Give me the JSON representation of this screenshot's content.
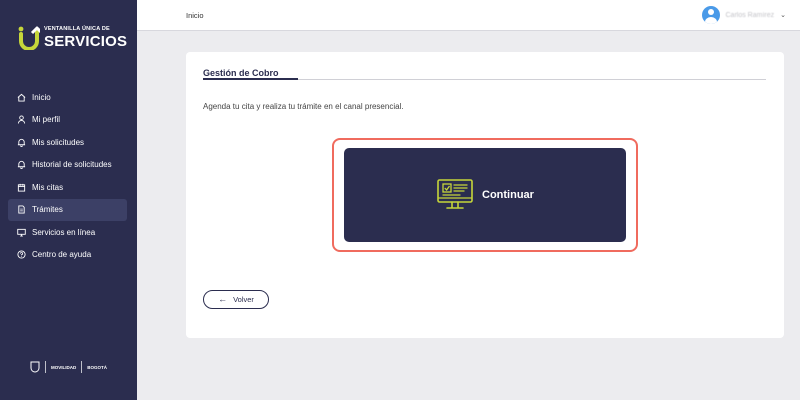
{
  "brand": {
    "top": "VENTANILLA ÚNICA DE",
    "main": "SERVICIOS",
    "accent": "#c6d63a",
    "primary": "#2b2d4f"
  },
  "header": {
    "breadcrumb": "Inicio",
    "user_name": "Carlos Ramírez"
  },
  "sidebar": {
    "items": [
      {
        "label": "Inicio",
        "icon": "home-icon"
      },
      {
        "label": "Mi perfil",
        "icon": "user-icon"
      },
      {
        "label": "Mis solicitudes",
        "icon": "bell-icon"
      },
      {
        "label": "Historial de solicitudes",
        "icon": "bell-icon"
      },
      {
        "label": "Mis citas",
        "icon": "calendar-icon"
      },
      {
        "label": "Trámites",
        "icon": "document-icon",
        "active": true
      },
      {
        "label": "Servicios en línea",
        "icon": "monitor-icon"
      },
      {
        "label": "Centro de ayuda",
        "icon": "help-icon"
      }
    ],
    "footer": {
      "logo1": "MOVILIDAD",
      "logo2": "BOGOTÁ"
    }
  },
  "main": {
    "title": "Gestión de Cobro",
    "description": "Agenda tu cita y realiza tu trámite en el canal presencial.",
    "cta_label": "Continuar",
    "back_label": "Volver"
  }
}
